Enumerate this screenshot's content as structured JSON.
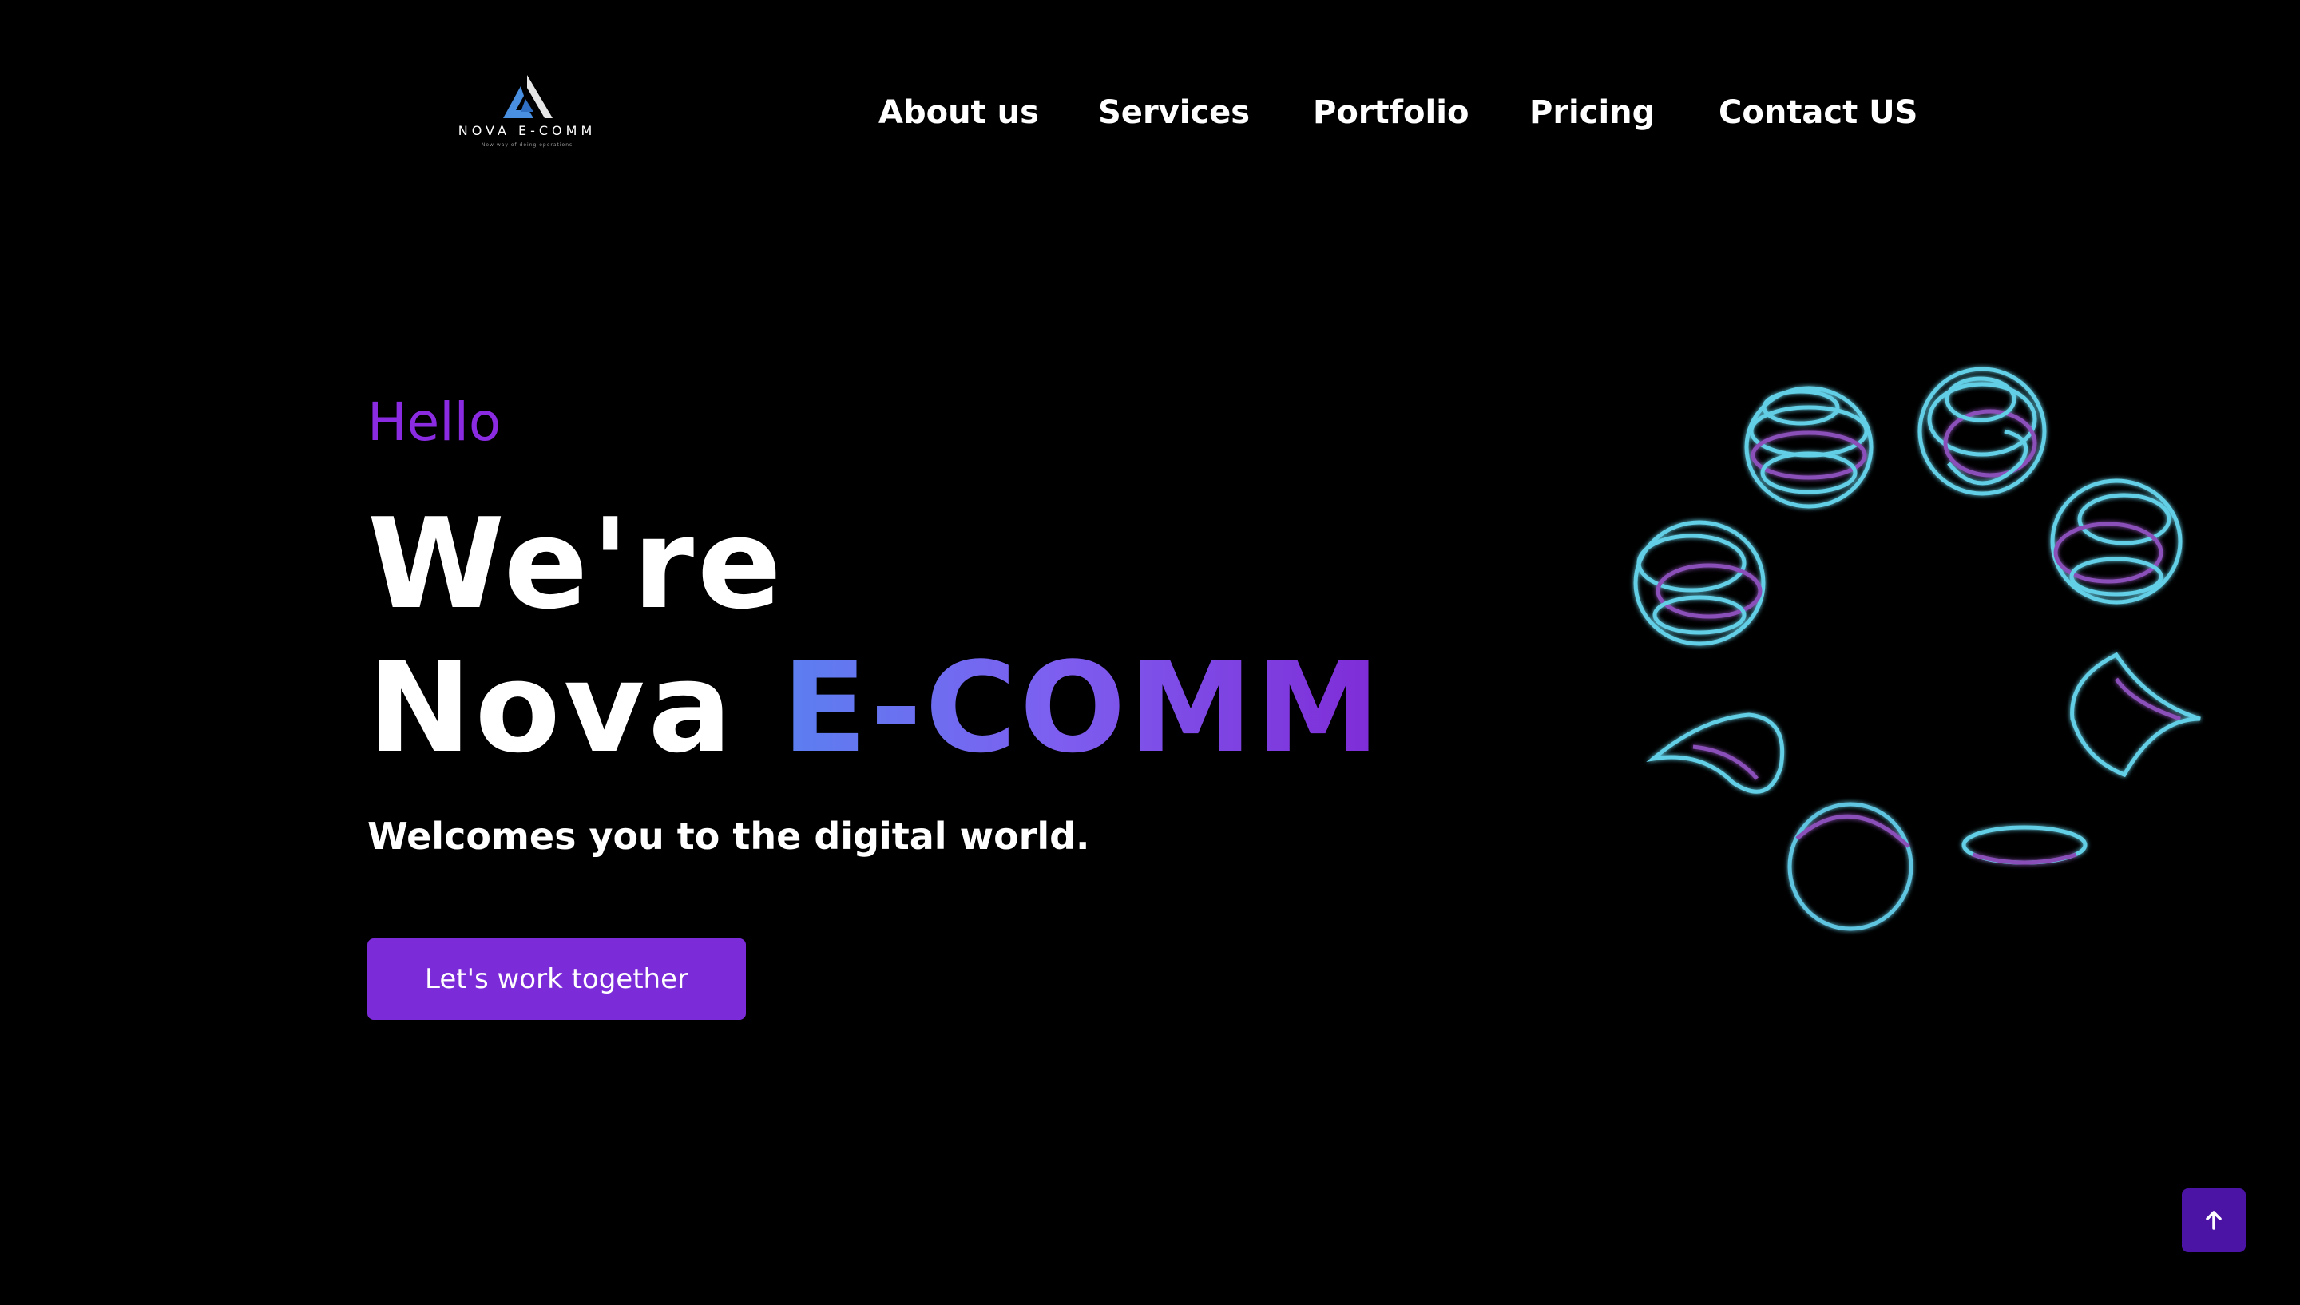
{
  "brand": {
    "name": "NOVA E-COMM",
    "tagline": "New way of doing operations",
    "accent": "#8a2be2",
    "button_color": "#7b2cd8",
    "scroll_button_color": "#4b14a5",
    "logo_icon": "triangle-logo-icon"
  },
  "nav": {
    "items": [
      {
        "label": "About us"
      },
      {
        "label": "Services"
      },
      {
        "label": "Portfolio"
      },
      {
        "label": "Pricing"
      },
      {
        "label": "Contact US"
      }
    ]
  },
  "hero": {
    "hello": "Hello",
    "line1": "We're",
    "line2_plain": "Nova",
    "line2_highlight": "E-COMM",
    "subtitle": "Welcomes you to the digital world.",
    "cta_label": "Let's work together"
  },
  "scroll_top": {
    "icon": "arrow-up-icon"
  }
}
